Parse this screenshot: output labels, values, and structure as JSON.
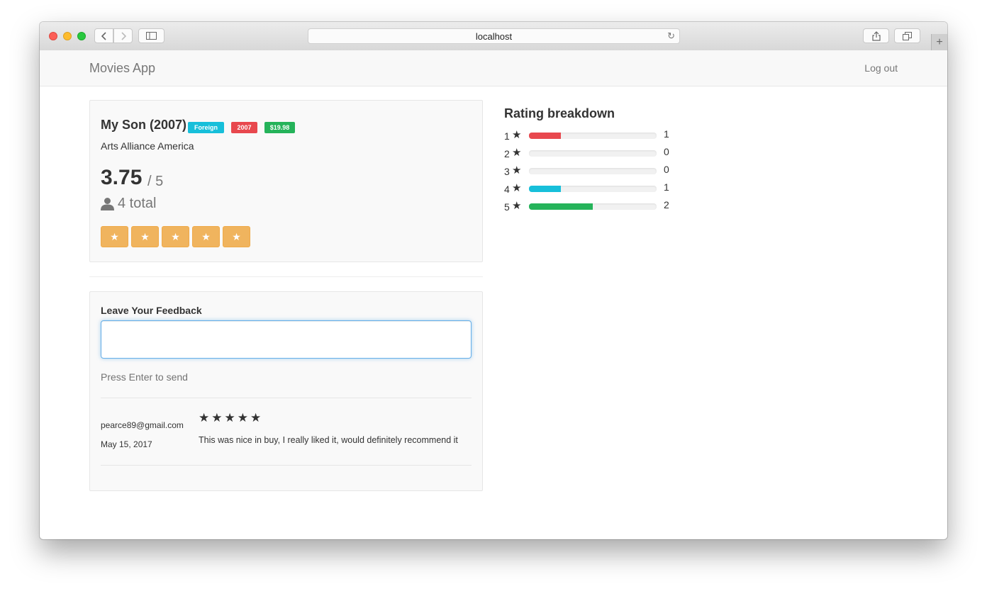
{
  "browser": {
    "url": "localhost"
  },
  "navbar": {
    "brand": "Movies App",
    "logout": "Log out"
  },
  "movie": {
    "title": "My Son (2007)",
    "badges": [
      {
        "label": "Foreign",
        "color": "#17bfda"
      },
      {
        "label": "2007",
        "color": "#e8484e"
      },
      {
        "label": "$19.98",
        "color": "#25b35a"
      }
    ],
    "studio": "Arts Alliance America",
    "score": "3.75",
    "score_out_of": "/ 5",
    "total": "4 total",
    "rate_stars": [
      "★",
      "★",
      "★",
      "★",
      "★"
    ]
  },
  "feedback": {
    "label": "Leave Your Feedback",
    "input_value": "",
    "help": "Press Enter to send",
    "reviews": [
      {
        "email": "pearce89@gmail.com",
        "date": "May 15, 2017",
        "stars": "★★★★★",
        "text": "This was nice in buy, I really liked it, would definitely recommend it"
      }
    ]
  },
  "breakdown": {
    "title": "Rating breakdown",
    "rows": [
      {
        "stars": "1",
        "count": "1",
        "fraction": 0.25,
        "color": "#e8484e"
      },
      {
        "stars": "2",
        "count": "0",
        "fraction": 0,
        "color": "#f1f1f1"
      },
      {
        "stars": "3",
        "count": "0",
        "fraction": 0,
        "color": "#f1f1f1"
      },
      {
        "stars": "4",
        "count": "1",
        "fraction": 0.25,
        "color": "#17bfda"
      },
      {
        "stars": "5",
        "count": "2",
        "fraction": 0.5,
        "color": "#25b35a"
      }
    ]
  },
  "colors": {
    "star_button": "#f0ad4e",
    "focus": "#66afe9"
  }
}
